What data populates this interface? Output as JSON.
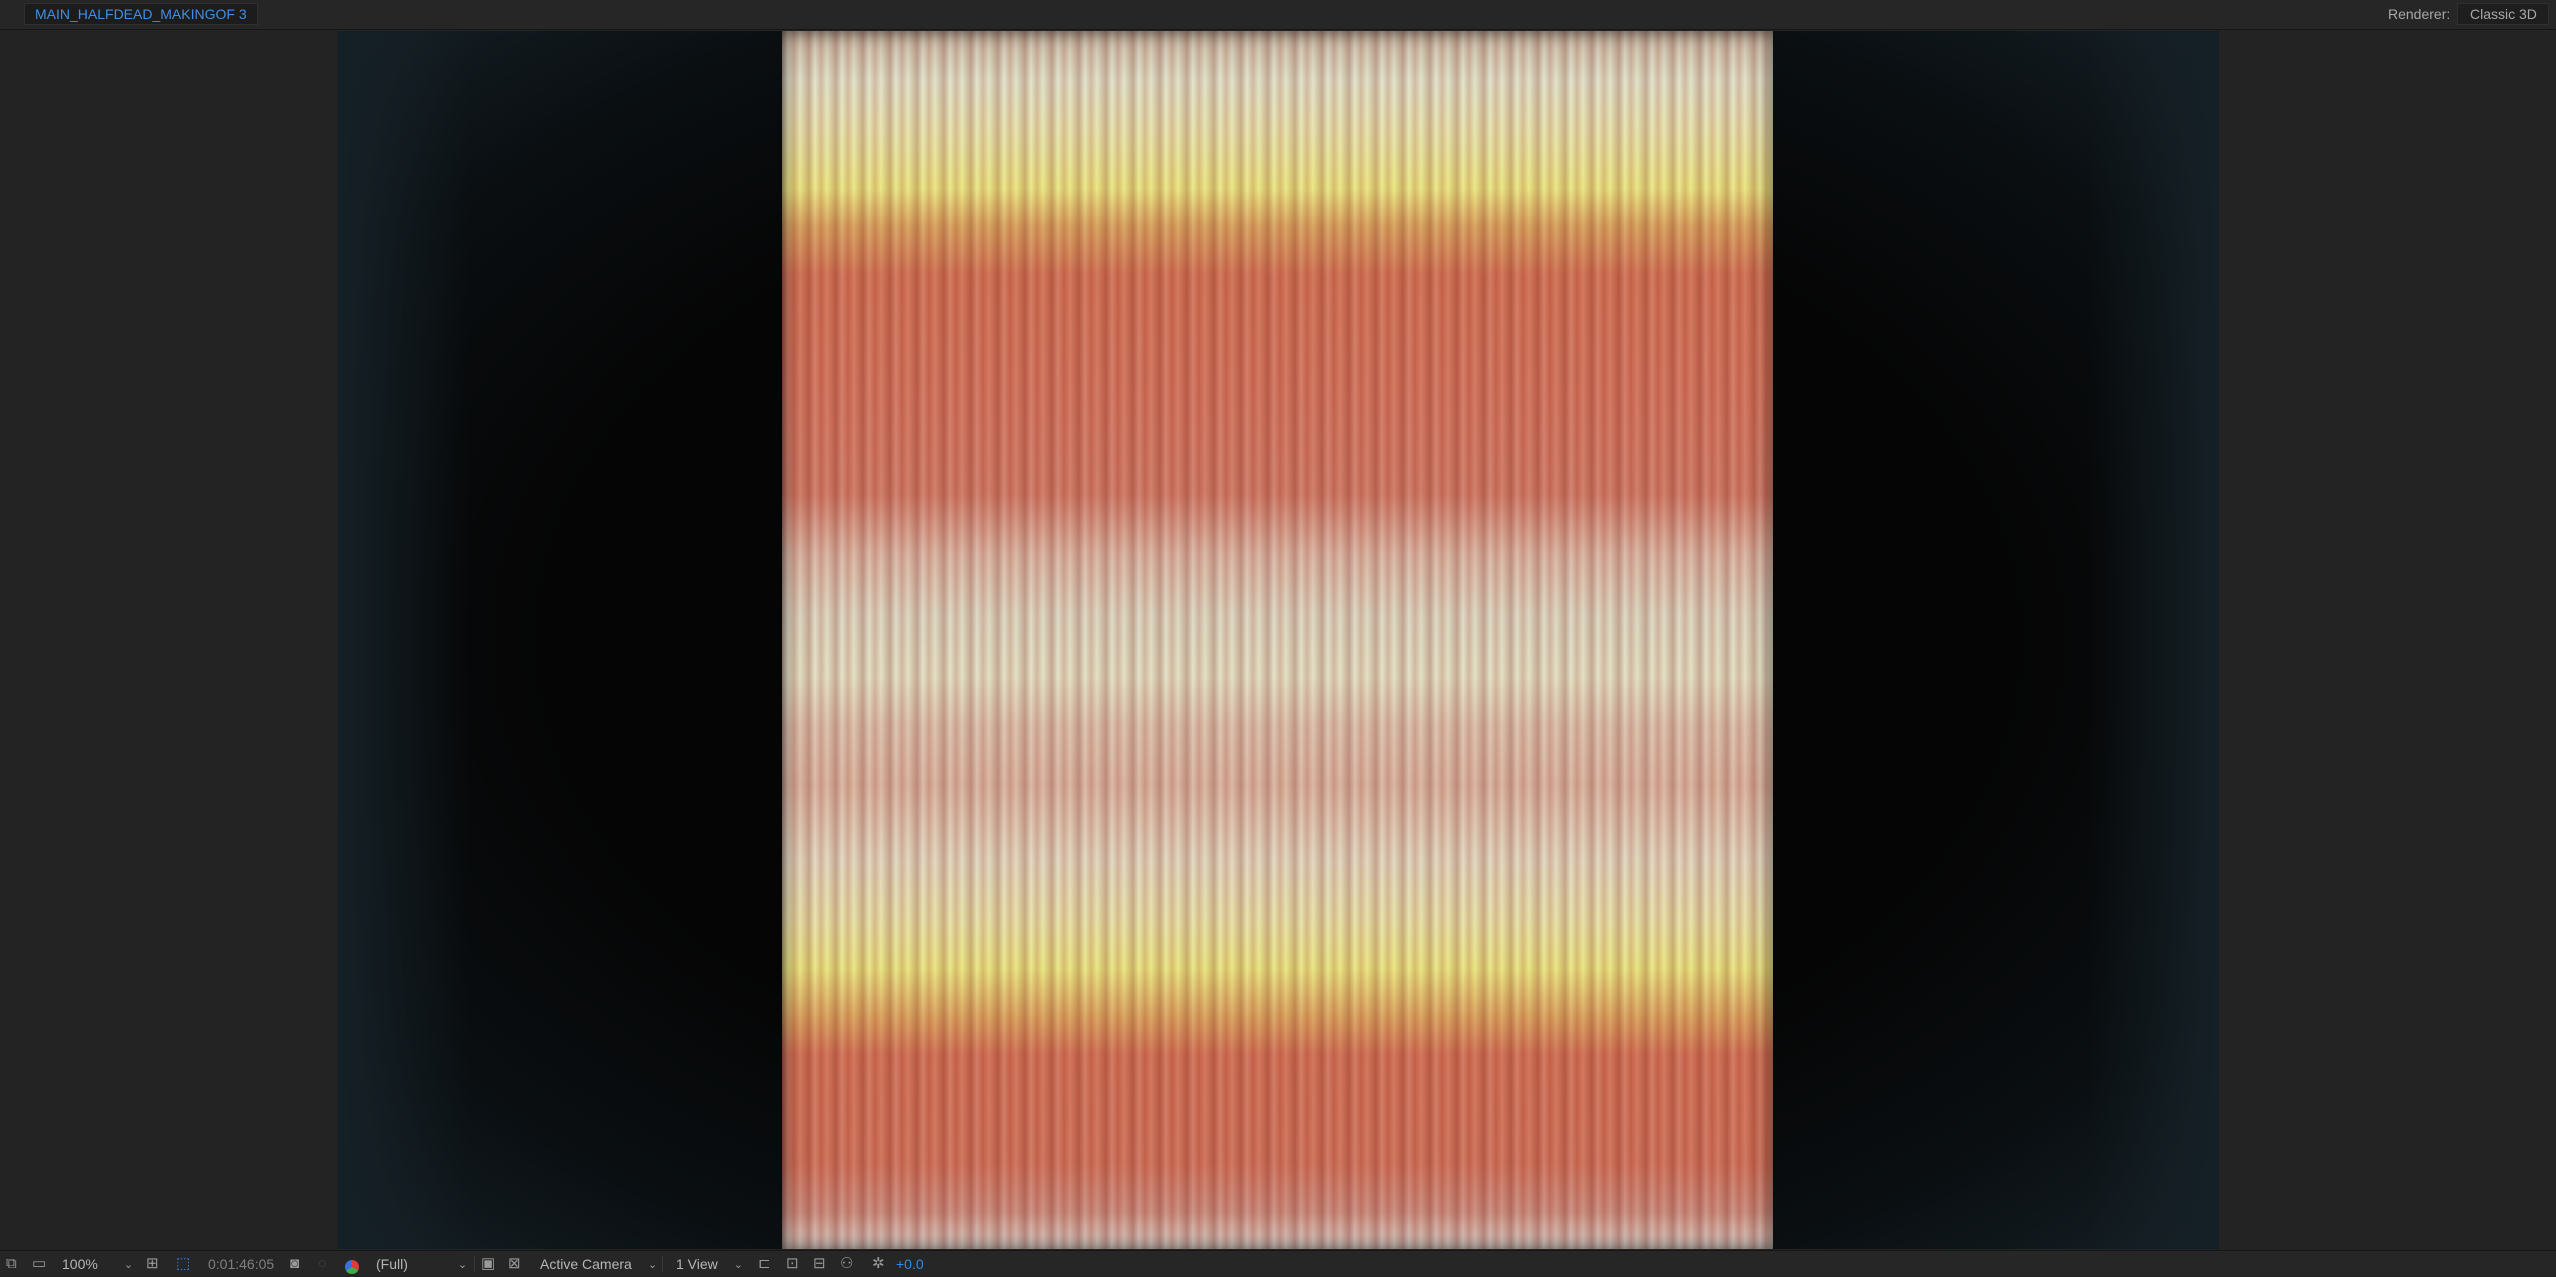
{
  "header": {
    "comp_tab_label": "MAIN_HALFDEAD_MAKINGOF 3",
    "renderer_label": "Renderer:",
    "renderer_value": "Classic 3D"
  },
  "viewer": {
    "content": "vertically striped footage frame in peach, pale yellow and cream tones"
  },
  "toolbar": {
    "zoom_value": "100%",
    "timecode": "0:01:46:05",
    "resolution_value": "(Full)",
    "camera_value": "Active Camera",
    "views_value": "1 View",
    "exposure_value": "+0.0"
  },
  "icons": [
    "always-preview-icon",
    "monitor-icon",
    "grid-guides-icon",
    "mask-visibility-icon",
    "snapshot-camera-icon",
    "show-snapshot-icon",
    "color-channel-icon",
    "region-of-interest-icon",
    "transparency-grid-icon",
    "3d-view-icon",
    "fast-preview-icon",
    "timeline-icon",
    "flowchart-icon",
    "reset-exposure-icon"
  ],
  "colors": {
    "accent": "#2d8ceb",
    "panel_bg": "#232323",
    "comp_bg": "#050505"
  }
}
